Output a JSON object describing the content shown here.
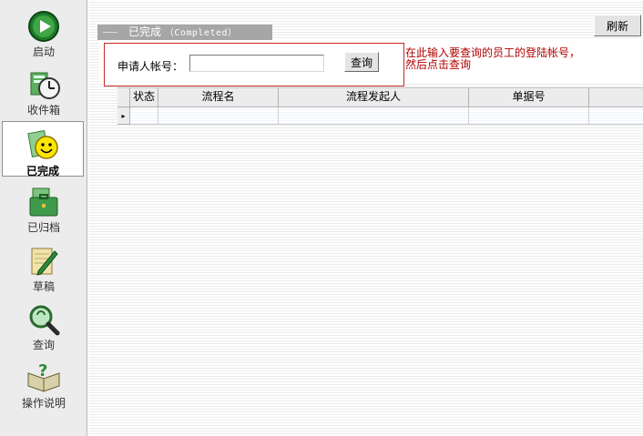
{
  "sidebar": {
    "items": [
      {
        "label": "启动",
        "icon": "play-icon"
      },
      {
        "label": "收件箱",
        "icon": "inbox-clock-icon"
      },
      {
        "label": "已完成",
        "icon": "smiley-completed-icon",
        "active": true
      },
      {
        "label": "已归档",
        "icon": "archive-briefcase-icon"
      },
      {
        "label": "草稿",
        "icon": "draft-pencil-icon"
      },
      {
        "label": "查询",
        "icon": "magnifier-query-icon"
      },
      {
        "label": "操作说明",
        "icon": "help-book-icon"
      }
    ]
  },
  "toolbar": {
    "refresh_label": "刷新"
  },
  "section": {
    "title_cn": "已完成",
    "title_en": "（Completed）"
  },
  "search": {
    "label": "申请人帐号：",
    "value": "",
    "button_label": "查询",
    "hint_line1": "在此输入要查询的员工的登陆帐号，",
    "hint_line2": "然后点击查询"
  },
  "table": {
    "columns": [
      "状态",
      "流程名",
      "流程发起人",
      "单据号"
    ],
    "row_indicator": "▸"
  },
  "colors": {
    "hint": "#b00000",
    "search_border": "#c82828",
    "tab_bg": "#a6a6a6"
  }
}
